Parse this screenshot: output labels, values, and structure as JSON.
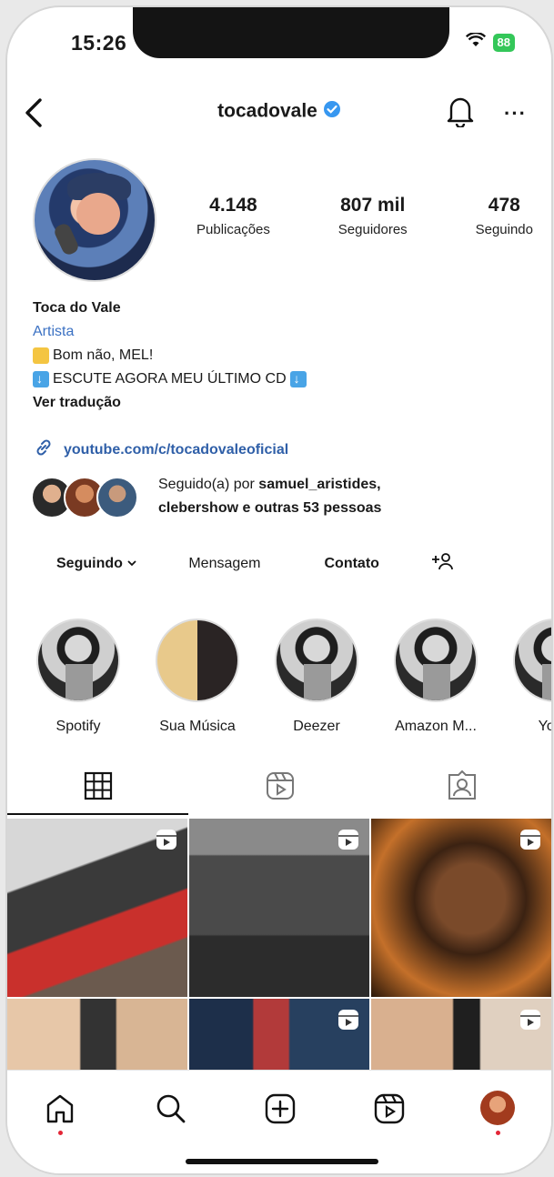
{
  "status": {
    "time": "15:26",
    "battery": "88"
  },
  "header": {
    "username": "tocadovale",
    "verified": true,
    "more_label": "···"
  },
  "profile": {
    "stats": [
      {
        "value": "4.148",
        "label": "Publicações"
      },
      {
        "value": "807 mil",
        "label": "Seguidores"
      },
      {
        "value": "478",
        "label": "Seguindo"
      }
    ],
    "name": "Toca do Vale",
    "category": "Artista",
    "bio_line_1": "Bom não, MEL!",
    "bio_line_2": "ESCUTE AGORA MEU ÚLTIMO CD",
    "translate": "Ver tradução",
    "link": "youtube.com/c/tocadovaleoficial",
    "followed_by_prefix": "Seguido(a) por ",
    "followed_by_names": "samuel_aristides,",
    "followed_by_line2": "clebershow e outras 53 pessoas"
  },
  "actions": {
    "following": "Seguindo",
    "message": "Mensagem",
    "contact": "Contato"
  },
  "highlights": [
    {
      "label": "Spotify"
    },
    {
      "label": "Sua Música"
    },
    {
      "label": "Deezer"
    },
    {
      "label": "Amazon M..."
    },
    {
      "label": "YouT"
    }
  ],
  "colors": {
    "link": "#2f5fa8",
    "verified": "#3797f0",
    "notification_dot": "#e32636"
  }
}
